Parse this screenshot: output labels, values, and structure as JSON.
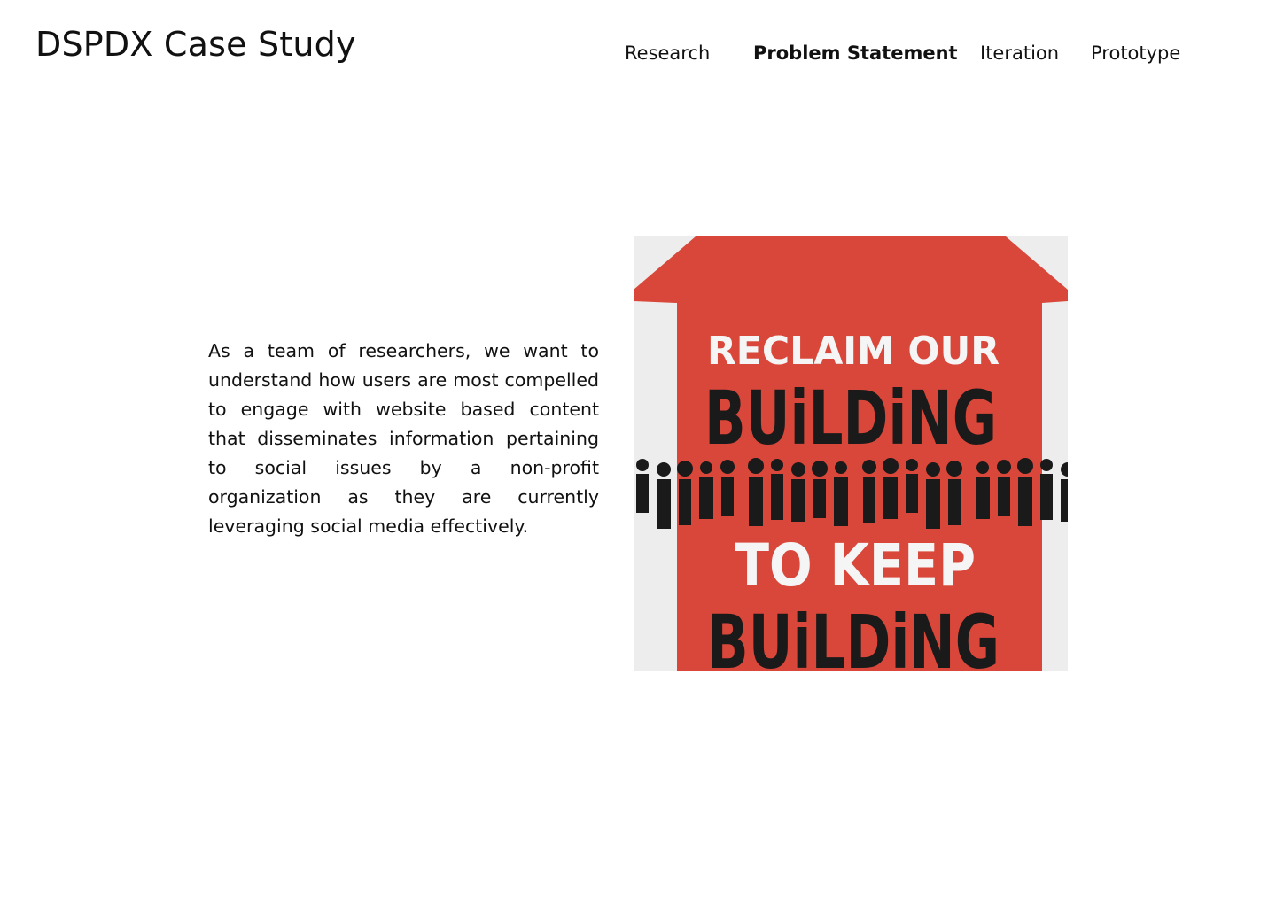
{
  "header": {
    "title": "DSPDX Case Study"
  },
  "nav": {
    "items": [
      {
        "label": "Research"
      },
      {
        "label": "Problem Statement"
      },
      {
        "label": "Iteration"
      },
      {
        "label": "Prototype"
      }
    ],
    "active": "Problem Statement"
  },
  "main": {
    "statement": "As a team of researchers, we want to understand how users are most compelled to engage with website based content that disseminates information pertaining to social issues by a non-profit organization as they are currently leveraging social media effectively."
  },
  "poster": {
    "line1": "RECLAIM OUR",
    "line2": "BUiLDiNG",
    "line3": "TO KEEP",
    "line4": "BUiLDiNG",
    "colors": {
      "background": "#ededed",
      "red": "#d9473a",
      "black": "#1a1a1a",
      "white": "#f5f5f5"
    }
  }
}
